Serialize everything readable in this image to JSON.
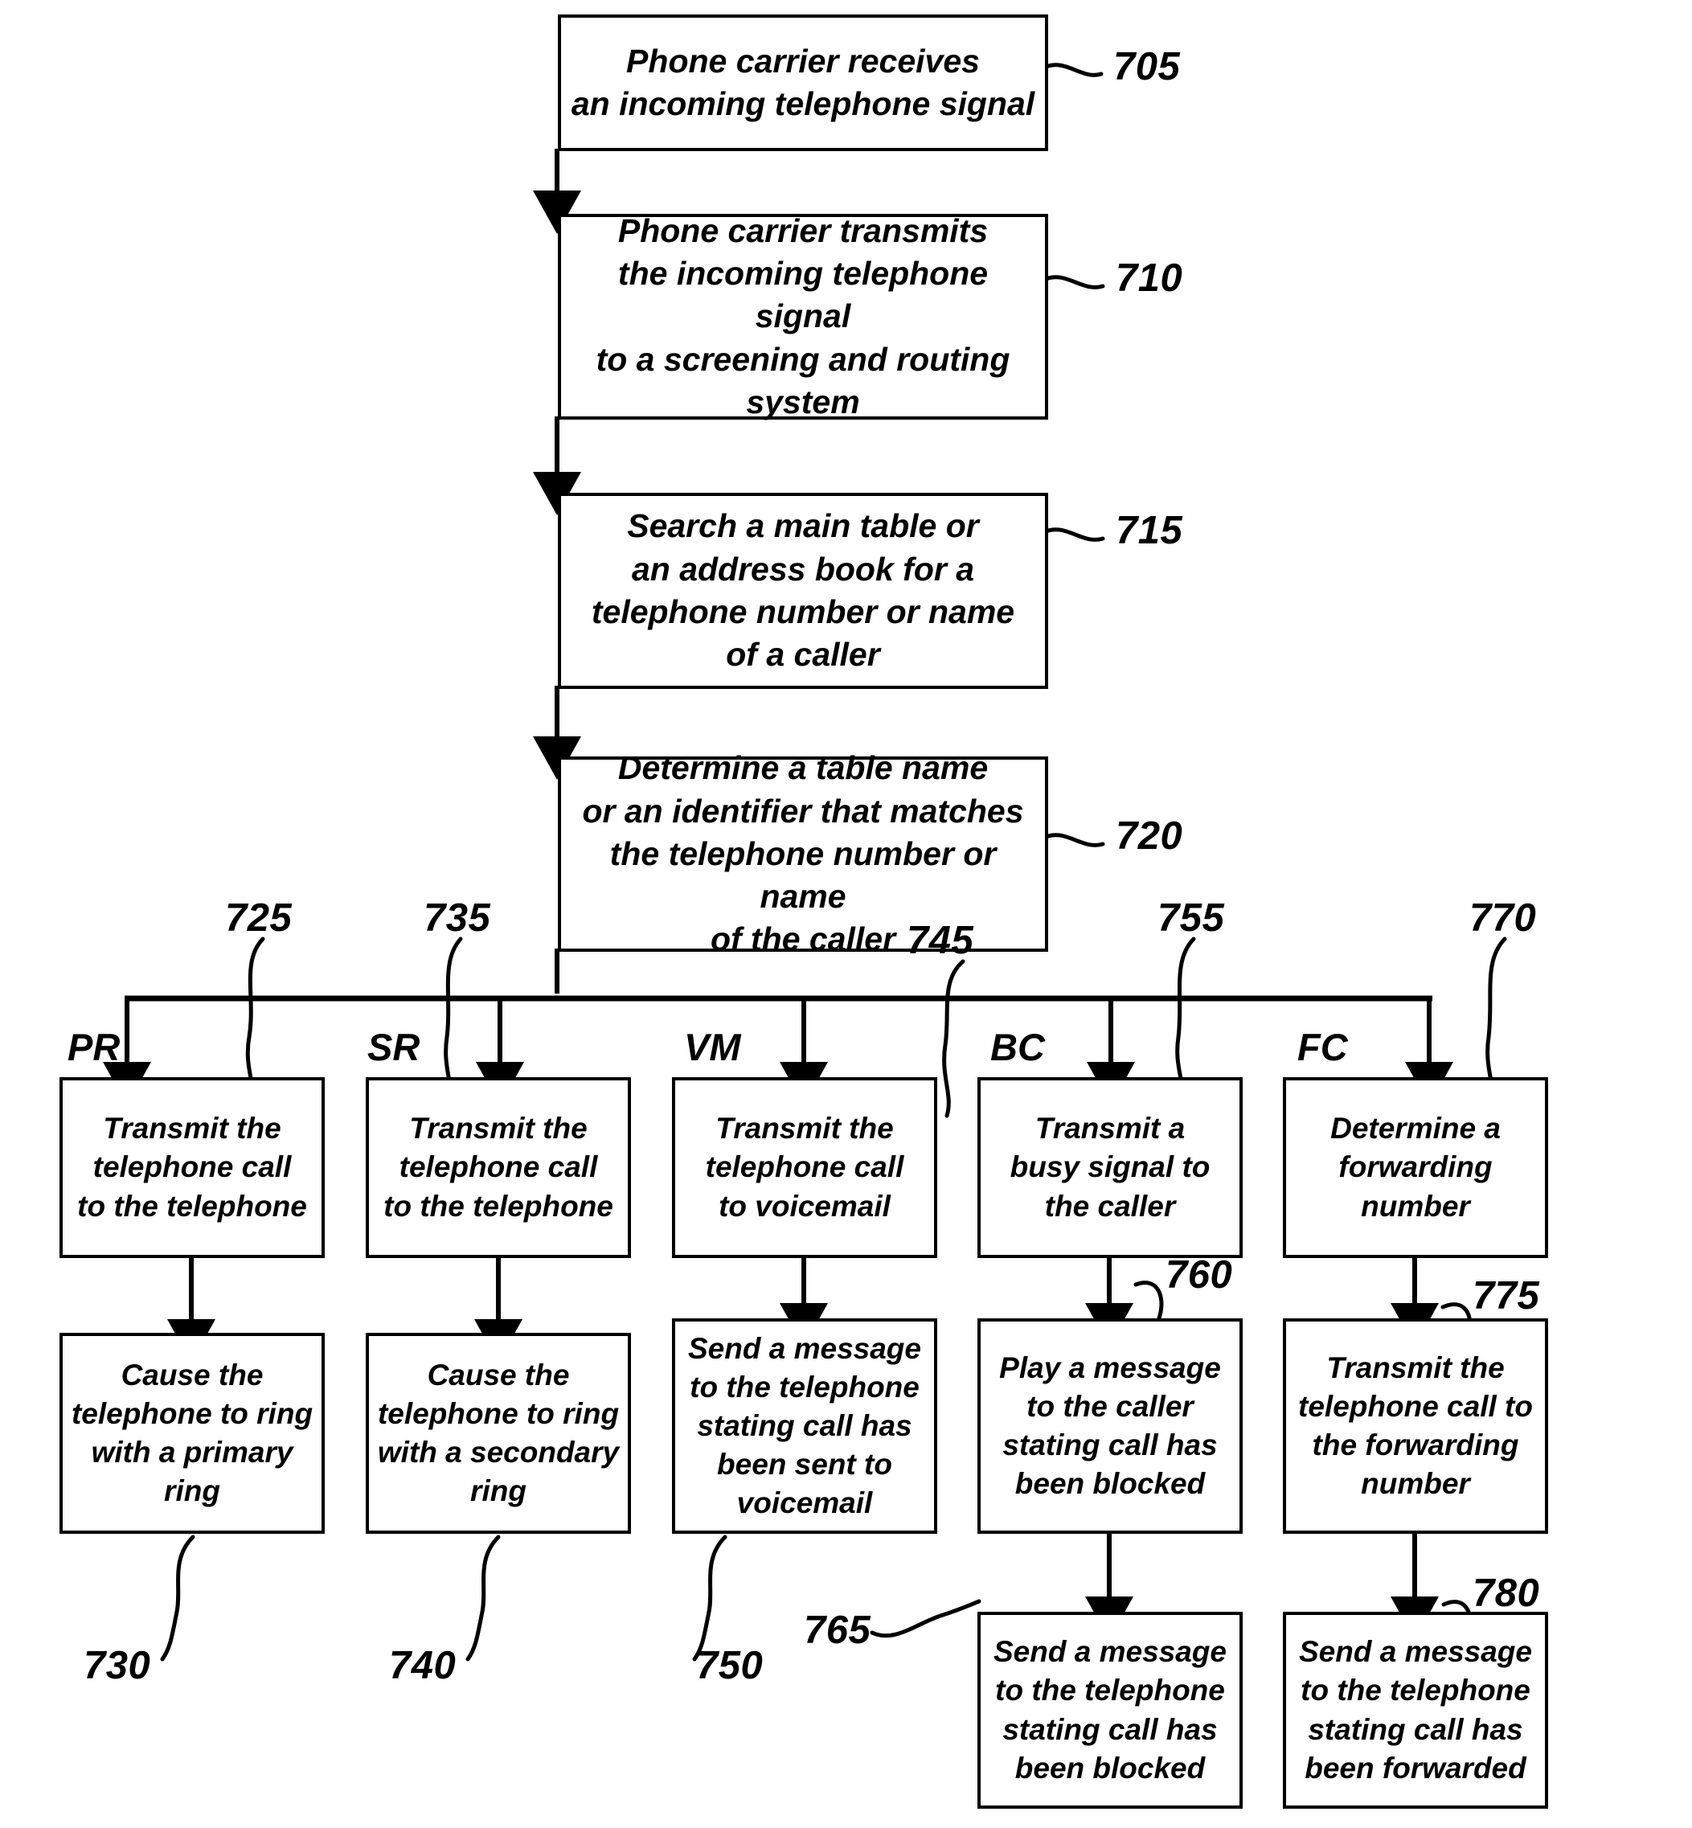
{
  "figure": {
    "type": "patent-flowchart",
    "background_color": "#ffffff",
    "ink_color": "#000000"
  },
  "boxes": {
    "b705": "Phone carrier receives\nan incoming telephone signal",
    "b710": "Phone carrier transmits\nthe incoming telephone signal\nto a screening and routing\nsystem",
    "b715": "Search a main table or\nan address book for a\ntelephone number or name\nof a caller",
    "b720": "Determine a table name\nor an identifier that matches\nthe telephone number or name\nof the caller",
    "b725": "Transmit the\ntelephone call\nto the telephone",
    "b730": "Cause the\ntelephone to ring\nwith a primary\nring",
    "b735": "Transmit the\ntelephone call\nto the telephone",
    "b740": "Cause the\ntelephone to ring\nwith a secondary\nring",
    "b745": "Transmit the\ntelephone call\nto voicemail",
    "b750": "Send a message\nto the telephone\nstating call has\nbeen sent to\nvoicemail",
    "b755": "Transmit a\nbusy signal to\nthe caller",
    "b760": "Play a message\nto the caller\nstating call has\nbeen blocked",
    "b765": "Send a message\nto the telephone\nstating call has\nbeen blocked",
    "b770": "Determine a\nforwarding\nnumber",
    "b775": "Transmit the\ntelephone call to\nthe forwarding\nnumber",
    "b780": "Send a message\nto the telephone\nstating call has\nbeen forwarded"
  },
  "refnums": {
    "n705": "705",
    "n710": "710",
    "n715": "715",
    "n720": "720",
    "n725": "725",
    "n730": "730",
    "n735": "735",
    "n740": "740",
    "n745": "745",
    "n750": "750",
    "n755": "755",
    "n760": "760",
    "n765": "765",
    "n770": "770",
    "n775": "775",
    "n780": "780"
  },
  "route_labels": {
    "pr": "PR",
    "sr": "SR",
    "vm": "VM",
    "bc": "BC",
    "fc": "FC"
  }
}
